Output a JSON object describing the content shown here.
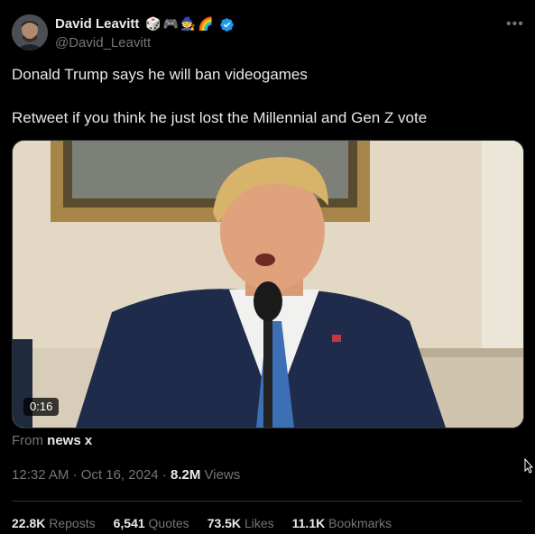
{
  "author": {
    "display_name": "David Leavitt",
    "handle": "@David_Leavitt",
    "emojis": [
      "🎲",
      "🎮",
      "🧙",
      "🌈"
    ],
    "verified": true
  },
  "tweet": {
    "line1": "Donald Trump says he will ban videogames",
    "line2": "Retweet if you think he just lost the Millennial and Gen Z vote"
  },
  "media": {
    "duration": "0:16"
  },
  "source": {
    "prefix": "From",
    "name": "news x"
  },
  "meta": {
    "time": "12:32 AM",
    "date": "Oct 16, 2024",
    "views_count": "8.2M",
    "views_label": "Views"
  },
  "stats": {
    "reposts_count": "22.8K",
    "reposts_label": "Reposts",
    "quotes_count": "6,541",
    "quotes_label": "Quotes",
    "likes_count": "73.5K",
    "likes_label": "Likes",
    "bookmarks_count": "11.1K",
    "bookmarks_label": "Bookmarks"
  },
  "colors": {
    "background": "#000000",
    "text_primary": "#e7e9ea",
    "text_secondary": "#71767b",
    "divider": "#2f3336",
    "verified": "#1d9bf0"
  }
}
